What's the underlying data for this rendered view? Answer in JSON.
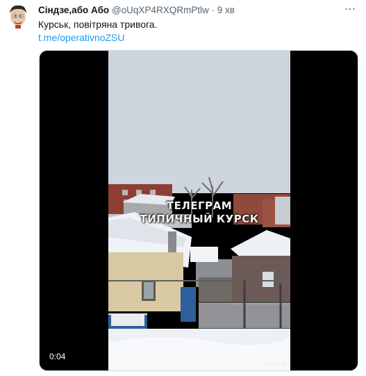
{
  "tweet": {
    "display_name": "Сіндзе,або Або",
    "handle": "@oUqXP4RXQRmPtlw",
    "separator": "·",
    "time": "9 хв",
    "text": "Курськ, повітряна тривога.",
    "link": "t.me/operativnoZSU",
    "more_icon": "⋯"
  },
  "video": {
    "duration": "0:04",
    "watermark_line1": "ТЕЛЕГРАМ",
    "watermark_line2": "ТИПИЧНЫЙ КУРСК",
    "logo": "InShOt"
  }
}
